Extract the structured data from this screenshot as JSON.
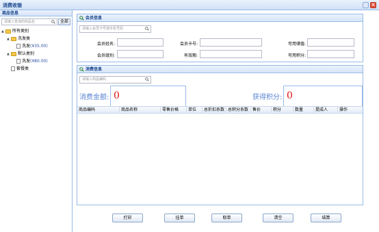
{
  "window": {
    "title": "消费收银"
  },
  "sidebar": {
    "header": "商品信息",
    "search_placeholder": "请输入查询的商品名",
    "all_button": "全部",
    "tree": [
      {
        "label": "所有类别",
        "level": 0
      },
      {
        "label": "洗发类",
        "level": 1
      },
      {
        "label": "洗发",
        "price": "(¥35.00)",
        "level": 2
      },
      {
        "label": "默认类别",
        "level": 1
      },
      {
        "label": "洗发",
        "price": "(¥80.00)",
        "level": 2
      },
      {
        "label": "套餐类",
        "level": 1
      }
    ]
  },
  "member": {
    "header": "会员信息",
    "search_placeholder": "请输入会员卡号或手机号码",
    "fields": {
      "name": "会员姓名:",
      "card": "会员卡号:",
      "balance": "可用储值:",
      "level": "会员级别:",
      "expiry": "有效期:",
      "points": "可用积分:"
    }
  },
  "consume": {
    "header": "消费信息",
    "search_placeholder": "请输入商品编码",
    "amount_label": "消费金额:",
    "amount_value": "0",
    "points_label": "获得积分:",
    "points_value": "0",
    "columns": [
      "商品编码",
      "商品名称",
      "零售价格",
      "单位",
      "总折扣系数",
      "总积分系数",
      "售价",
      "积分",
      "数量",
      "提成人",
      "操作"
    ]
  },
  "buttons": {
    "print": "打印",
    "hang": "挂单",
    "fetch": "取单",
    "clear": "清空",
    "settle": "结算"
  }
}
